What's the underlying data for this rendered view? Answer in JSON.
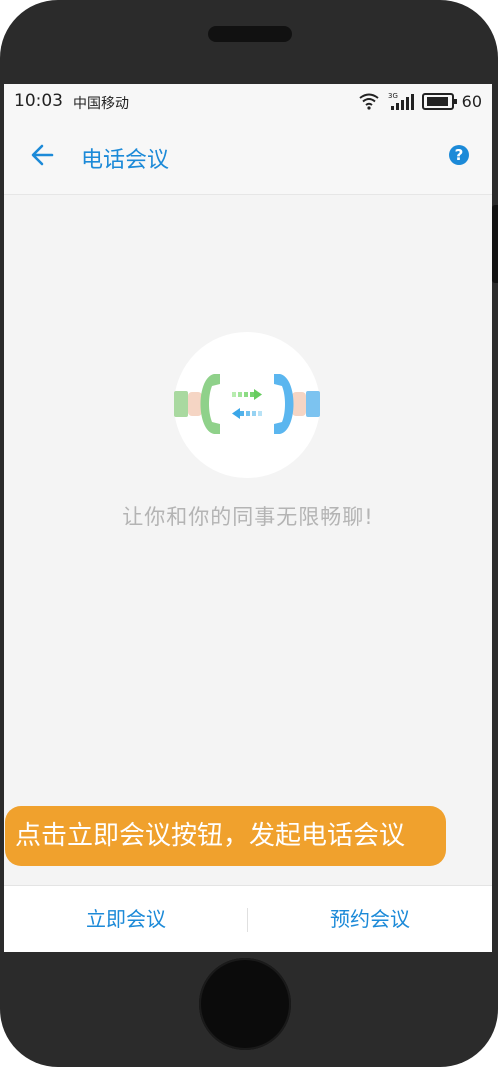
{
  "status_bar": {
    "time": "10:03",
    "carrier": "中国移动",
    "network_type": "3G",
    "battery_level": "60",
    "icons": [
      "wifi-icon",
      "cellular-signal-icon",
      "battery-icon"
    ]
  },
  "app_bar": {
    "title": "电话会议",
    "back_icon": "arrow-left-icon",
    "help_icon": "question-circle-icon",
    "help_glyph": "?"
  },
  "empty_state": {
    "illustration": "phone-handoff-illustration",
    "message": "让你和你的同事无限畅聊!"
  },
  "toast": {
    "text": "点击立即会议按钮，发起电话会议"
  },
  "bottom_bar": {
    "start_now_label": "立即会议",
    "schedule_label": "预约会议"
  },
  "colors": {
    "accent": "#1c8ad8",
    "toast_bg": "#f0a12d",
    "phone_body": "#2b2b2b",
    "screen_bg": "#f4f4f4"
  }
}
